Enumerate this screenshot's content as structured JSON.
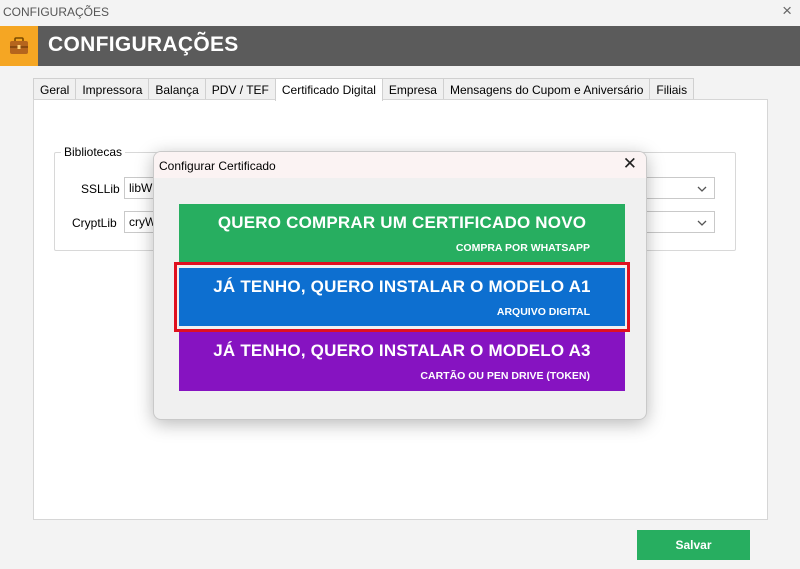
{
  "window": {
    "title": "CONFIGURAÇÕES",
    "close_icon": "×"
  },
  "header": {
    "title": "CONFIGURAÇÕES",
    "icon": "briefcase-icon",
    "accent": "#f5a623",
    "bg": "#5b5b5b"
  },
  "tabs": [
    {
      "label": "Geral"
    },
    {
      "label": "Impressora"
    },
    {
      "label": "Balança"
    },
    {
      "label": "PDV / TEF"
    },
    {
      "label": "Certificado Digital",
      "active": true
    },
    {
      "label": "Empresa"
    },
    {
      "label": "Mensagens do Cupom e Aniversário"
    },
    {
      "label": "Filiais"
    }
  ],
  "bibliotecas": {
    "legend": "Bibliotecas",
    "ssllib": {
      "label": "SSLLib",
      "value": "libW"
    },
    "cryptlib": {
      "label": "CryptLib",
      "value": "cryW"
    }
  },
  "dialog": {
    "title": "Configurar Certificado",
    "close_icon": "✕",
    "options": [
      {
        "main": "QUERO COMPRAR UM CERTIFICADO NOVO",
        "sub": "COMPRA POR WHATSAPP",
        "color": "#27ae60"
      },
      {
        "main": "JÁ TENHO, QUERO INSTALAR O MODELO A1",
        "sub": "ARQUIVO DIGITAL",
        "color": "#0d6fd0",
        "highlighted": true
      },
      {
        "main": "JÁ TENHO, QUERO INSTALAR O MODELO A3",
        "sub": "CARTÃO OU PEN DRIVE (TOKEN)",
        "color": "#8613c1"
      }
    ]
  },
  "footer": {
    "save_label": "Salvar",
    "save_color": "#27ae60"
  }
}
